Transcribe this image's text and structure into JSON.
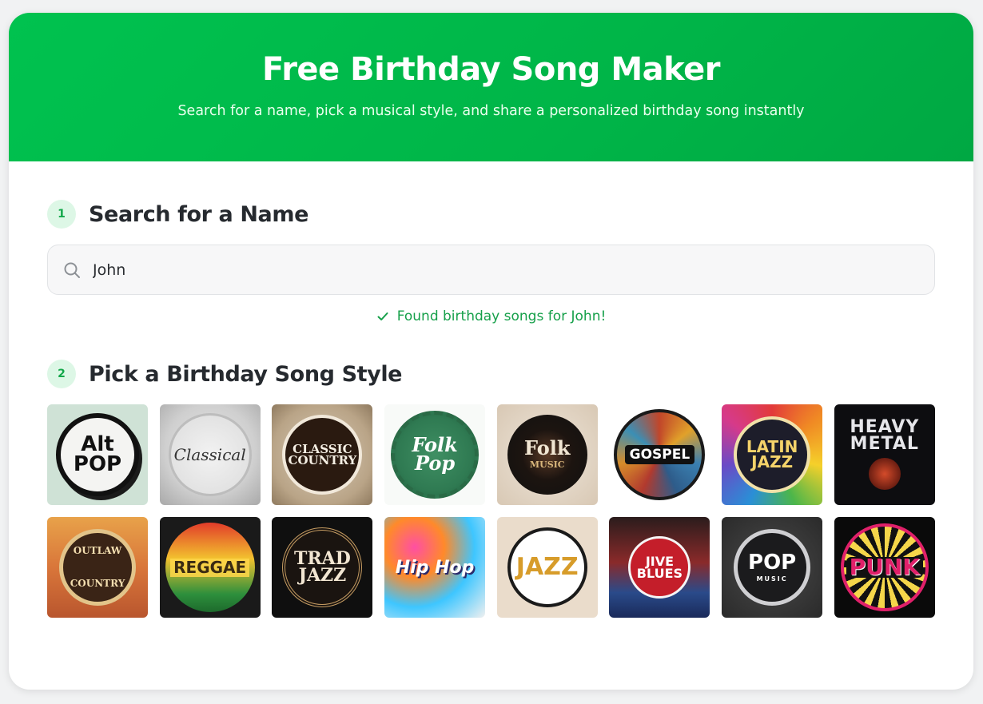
{
  "header": {
    "title": "Free Birthday Song Maker",
    "subtitle": "Search for a name, pick a musical style, and share a personalized birthday song instantly"
  },
  "step1": {
    "number": "1",
    "title": "Search for a Name"
  },
  "search": {
    "value": "John",
    "placeholder": ""
  },
  "status": {
    "text": "Found birthday songs for John!"
  },
  "step2": {
    "number": "2",
    "title": "Pick a Birthday Song Style"
  },
  "styles": [
    {
      "label": "Alt Pop",
      "line1": "Alt",
      "line2": "POP"
    },
    {
      "label": "Classical",
      "line1": "Classical",
      "line2": ""
    },
    {
      "label": "Classic Country",
      "line1": "CLASSIC",
      "line2": "COUNTRY"
    },
    {
      "label": "Folk Pop",
      "line1": "Folk",
      "line2": "Pop"
    },
    {
      "label": "Folk Music",
      "line1": "Folk",
      "line2": "MUSIC"
    },
    {
      "label": "Gospel",
      "line1": "GOSPEL",
      "line2": ""
    },
    {
      "label": "Latin Jazz",
      "line1": "LATIN",
      "line2": "JAZZ"
    },
    {
      "label": "Heavy Metal",
      "line1": "HEAVY",
      "line2": "METAL"
    },
    {
      "label": "Outlaw Country",
      "line1": "OUTLAW",
      "line2": "COUNTRY"
    },
    {
      "label": "Reggae",
      "line1": "REGGAE",
      "line2": ""
    },
    {
      "label": "Trad Jazz",
      "line1": "TRAD",
      "line2": "JAZZ"
    },
    {
      "label": "Hip Hop",
      "line1": "Hip Hop",
      "line2": ""
    },
    {
      "label": "Jazz",
      "line1": "JAZZ",
      "line2": ""
    },
    {
      "label": "Jive Blues",
      "line1": "JIVE",
      "line2": "BLUES"
    },
    {
      "label": "Pop Music",
      "line1": "POP",
      "line2": "MUSIC"
    },
    {
      "label": "Punk",
      "line1": "PUNK",
      "line2": ""
    }
  ],
  "colors": {
    "brand": "#00c24f",
    "success": "#16a04a",
    "step_bg": "#ddf7e6"
  }
}
